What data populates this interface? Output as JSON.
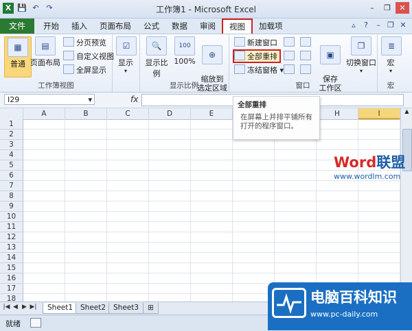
{
  "window": {
    "title": "工作簿1 - Microsoft Excel",
    "minimize": "–",
    "restore": "❐",
    "close": "✕"
  },
  "qat": {
    "save": "💾",
    "undo": "↶",
    "redo": "↷"
  },
  "menu": {
    "file": "文件",
    "tabs": [
      "开始",
      "插入",
      "页面布局",
      "公式",
      "数据",
      "审阅",
      "视图",
      "加载项"
    ],
    "active_tab": "视图"
  },
  "ribbon": {
    "groups": {
      "workbook_views": {
        "label": "工作簿视图",
        "normal": "普通",
        "page_layout": "页面布局",
        "page_break_preview": "分页预览",
        "custom_views": "自定义视图",
        "full_screen": "全屏显示"
      },
      "show": {
        "label": "显示"
      },
      "zoom": {
        "label": "显示比例",
        "zoom": "显示比例",
        "zoom100": "100%",
        "zoom_selection": "缩放到\n选定区域",
        "zoom100_icon": "100"
      },
      "window": {
        "label": "窗口",
        "new_window": "新建窗口",
        "arrange_all": "全部重排",
        "freeze_panes": "冻结窗格",
        "save_workspace": "保存\n工作区",
        "switch_windows": "切换窗口"
      },
      "macros": {
        "label": "宏",
        "macros": "宏"
      }
    }
  },
  "formula_bar": {
    "name_box": "I29",
    "fx": "fx",
    "formula": ""
  },
  "grid": {
    "columns": [
      "A",
      "B",
      "C",
      "D",
      "E",
      "F",
      "G",
      "H",
      "I"
    ],
    "selected_column": "I",
    "rows": [
      "1",
      "2",
      "3",
      "4",
      "5",
      "6",
      "7",
      "8",
      "9",
      "10",
      "11",
      "12",
      "13",
      "14",
      "15",
      "16",
      "17",
      "18"
    ]
  },
  "tooltip": {
    "title": "全部重排",
    "body": "在屏幕上并排平铺所有打开的程序窗口。"
  },
  "sheets": {
    "tabs": [
      "Sheet1",
      "Sheet2",
      "Sheet3"
    ],
    "active": "Sheet1",
    "nav": [
      "|◀",
      "◀",
      "▶",
      "▶|"
    ]
  },
  "status": {
    "ready": "就绪"
  },
  "watermark": {
    "word_part": "Word",
    "cn_part": "联盟",
    "url": "www.wordlm.com"
  },
  "badge": {
    "title": "电脑百科知识",
    "url": "www.pc-daily.com"
  },
  "colors": {
    "accent_red": "#d11f1f",
    "file_green": "#2b7a31",
    "badge_blue": "#1a6fc2"
  }
}
